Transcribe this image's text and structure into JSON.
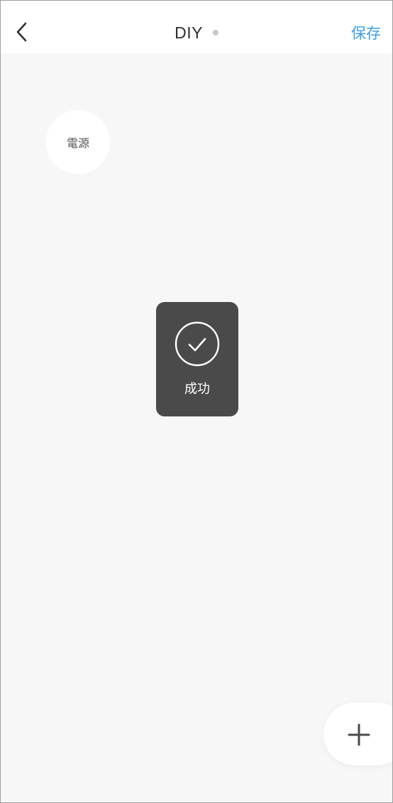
{
  "header": {
    "title": "DIY",
    "back_icon": "chevron-left-icon",
    "status_dot_color": "#c8c8c8",
    "save_label": "保存",
    "save_color": "#3d9ee8"
  },
  "canvas": {
    "buttons": [
      {
        "label": "電源"
      }
    ]
  },
  "toast": {
    "icon": "checkmark-circle-icon",
    "message": "成功"
  },
  "fab": {
    "icon": "plus-icon"
  }
}
